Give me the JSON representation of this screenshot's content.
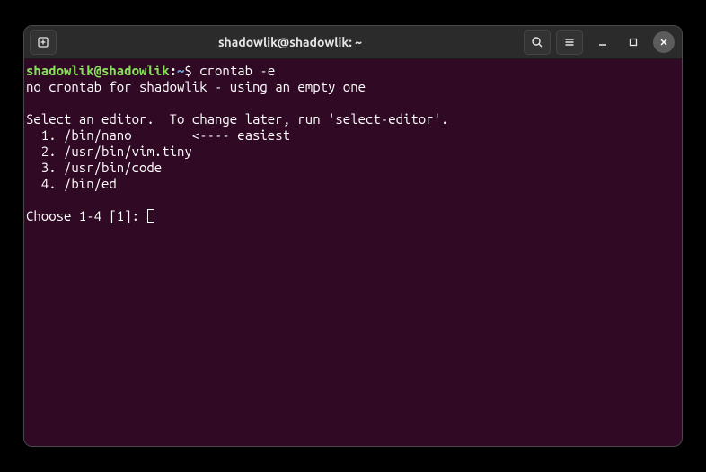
{
  "titlebar": {
    "title": "shadowlik@shadowlik: ~"
  },
  "prompt": {
    "user_host": "shadowlik@shadowlik",
    "colon": ":",
    "path": "~",
    "dollar": "$",
    "command": "crontab -e"
  },
  "output": {
    "line1": "no crontab for shadowlik - using an empty one",
    "blank": "",
    "select_msg": "Select an editor.  To change later, run 'select-editor'.",
    "opt1": "  1. /bin/nano        <---- easiest",
    "opt2": "  2. /usr/bin/vim.tiny",
    "opt3": "  3. /usr/bin/code",
    "opt4": "  4. /bin/ed",
    "choose": "Choose 1-4 [1]: "
  }
}
